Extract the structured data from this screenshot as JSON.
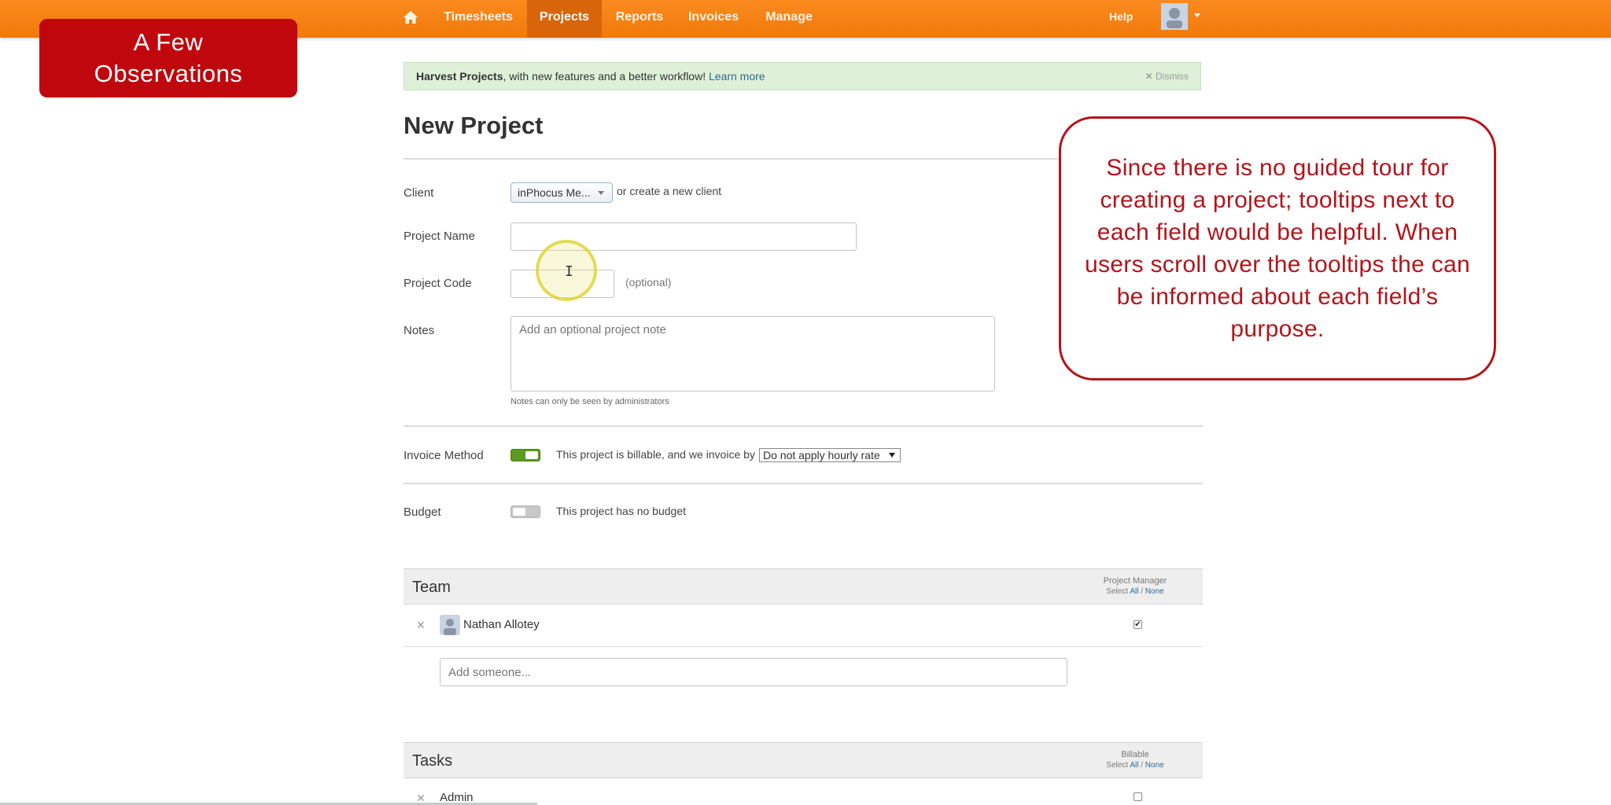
{
  "nav": {
    "home_icon": "home-icon",
    "items": [
      {
        "label": "Timesheets",
        "active": false
      },
      {
        "label": "Projects",
        "active": true
      },
      {
        "label": "Reports",
        "active": false
      },
      {
        "label": "Invoices",
        "active": false
      },
      {
        "label": "Manage",
        "active": false
      }
    ],
    "help_label": "Help",
    "avatar_icon": "user-avatar-icon"
  },
  "callouts": {
    "title": "A Few Observations",
    "tooltip_note": "Since there is no guided tour for creating a project; tooltips next to each field would be helpful. When users scroll over the tooltips the can be informed about each field’s purpose."
  },
  "banner": {
    "strong": "Harvest Projects",
    "text": ", with new features and a better workflow! ",
    "link": "Learn more",
    "dismiss": "Dismiss"
  },
  "form": {
    "title": "New Project",
    "client_label": "Client",
    "client_value": "inPhocus Me...",
    "client_alt": "or create a new client",
    "project_name_label": "Project Name",
    "project_name_value": "",
    "project_code_label": "Project Code",
    "project_code_value": "",
    "project_code_hint": "(optional)",
    "notes_label": "Notes",
    "notes_placeholder": "Add an optional project note",
    "notes_help": "Notes can only be seen by administrators",
    "invoice_label": "Invoice Method",
    "invoice_text": "This project is billable, and we invoice by",
    "invoice_rate": "Do not apply hourly rate",
    "budget_label": "Budget",
    "budget_text": "This project has no budget"
  },
  "team": {
    "title": "Team",
    "col_head": "Project Manager",
    "select_label": "Select",
    "all": "All",
    "none": "None",
    "members": [
      {
        "name": "Nathan Allotey",
        "pm": true
      }
    ],
    "add_placeholder": "Add someone..."
  },
  "tasks": {
    "title": "Tasks",
    "col_head": "Billable",
    "select_label": "Select",
    "all": "All",
    "none": "None",
    "rows": [
      {
        "name": "Admin",
        "billable": false
      }
    ]
  },
  "colors": {
    "nav": "#f7841a",
    "callout_red": "#c0070d",
    "banner_bg": "#dff0d8",
    "toggle_on": "#5b9a1e"
  }
}
